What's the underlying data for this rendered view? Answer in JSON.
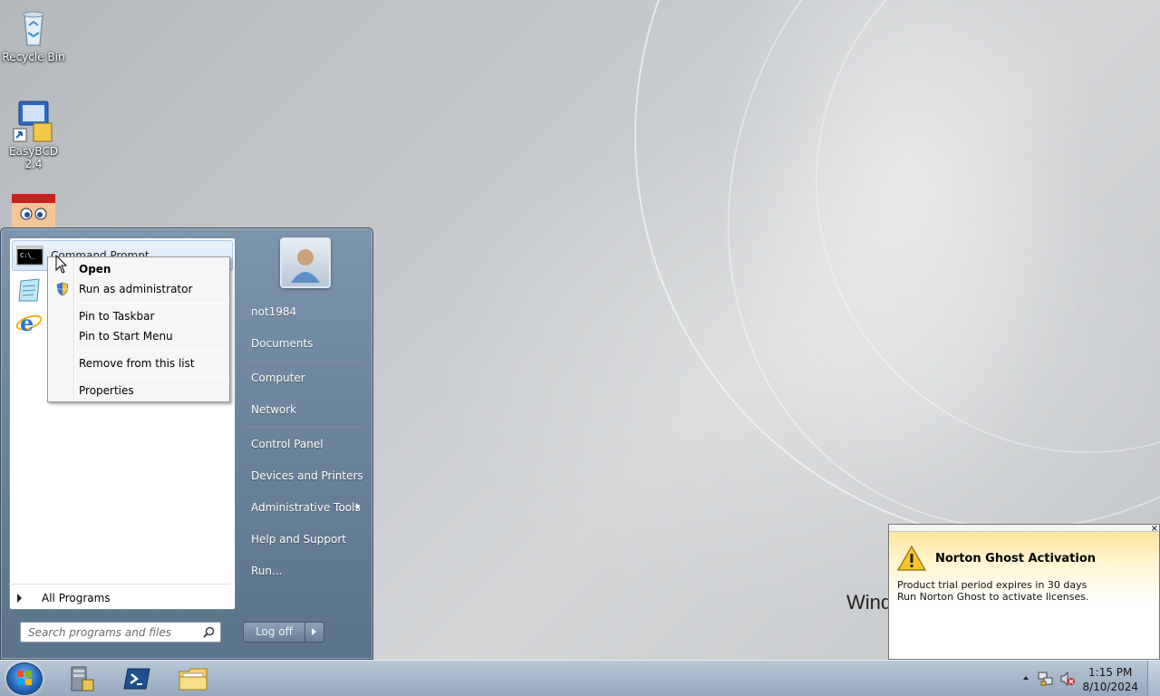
{
  "desktop": {
    "icons": [
      {
        "label": "Recycle Bin",
        "icon": "recycle-bin-icon"
      },
      {
        "label": "EasyBCD 2.4",
        "icon": "easybcd-icon"
      },
      {
        "label": "",
        "icon": "mario-icon"
      }
    ],
    "watermark": "Wind"
  },
  "start_menu": {
    "pinned_programs": [
      {
        "label": "Command Prompt",
        "icon": "command-prompt-icon"
      },
      {
        "label": "",
        "icon": "notepad-icon"
      },
      {
        "label": "",
        "icon": "internet-explorer-icon"
      }
    ],
    "all_programs": "All Programs",
    "search_placeholder": "Search programs and files",
    "right_items": {
      "user": "not1984",
      "documents": "Documents",
      "computer": "Computer",
      "network": "Network",
      "control_panel": "Control Panel",
      "devices": "Devices and Printers",
      "admin_tools": "Administrative Tools",
      "help": "Help and Support",
      "run": "Run..."
    },
    "logoff": "Log off"
  },
  "context_menu": {
    "open": "Open",
    "run_admin": "Run as administrator",
    "pin_taskbar": "Pin to Taskbar",
    "pin_start": "Pin to Start Menu",
    "remove": "Remove from this list",
    "properties": "Properties"
  },
  "notification": {
    "title": "Norton Ghost Activation",
    "line1": "Product trial period expires in 30 days",
    "line2": "Run Norton Ghost to activate licenses.",
    "close": "×"
  },
  "taskbar": {
    "pinned": [
      "server-manager-icon",
      "powershell-icon",
      "explorer-folder-icon"
    ],
    "time": "1:15 PM",
    "date": "8/10/2024"
  },
  "colors": {
    "start_menu_bg": "#6e869d",
    "taskbar_bg": "#a6b7c9",
    "balloon_gradient_top": "#fde394"
  }
}
